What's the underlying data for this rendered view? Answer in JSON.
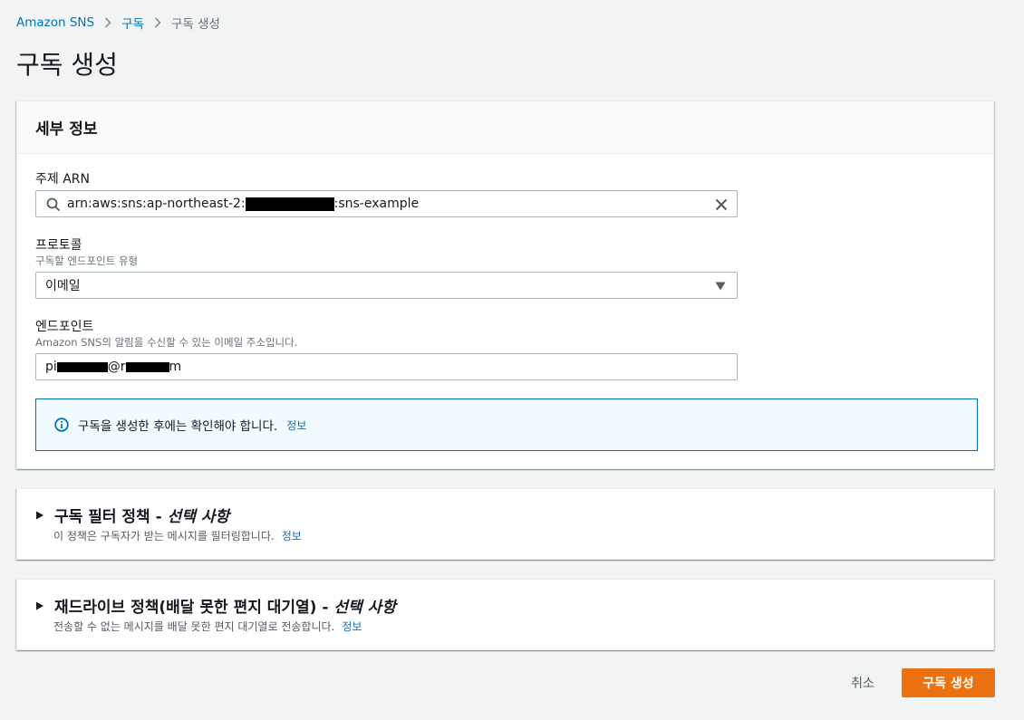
{
  "breadcrumb": {
    "items": [
      {
        "label": "Amazon SNS"
      },
      {
        "label": "구독"
      },
      {
        "label": "구독 생성"
      }
    ]
  },
  "page": {
    "title": "구독 생성"
  },
  "details": {
    "heading": "세부 정보",
    "topic_arn": {
      "label": "주제 ARN",
      "value_prefix": "arn:aws:sns:ap-northeast-2:",
      "value_suffix": ":sns-example",
      "icon": "search-icon",
      "clear_icon": "close-icon"
    },
    "protocol": {
      "label": "프로토콜",
      "description": "구독할 엔드포인트 유형",
      "value": "이메일",
      "icon": "caret-down-icon"
    },
    "endpoint": {
      "label": "엔드포인트",
      "description": "Amazon SNS의 알림을 수신할 수 있는 이메일 주소입니다.",
      "value_parts": [
        "pi",
        "@r",
        "m"
      ]
    },
    "alert": {
      "text": "구독을 생성한 후에는 확인해야 합니다.",
      "link": "정보",
      "icon": "info-icon"
    }
  },
  "filter_policy": {
    "title": "구독 필터 정책 - ",
    "title_optional": "선택 사항",
    "description": "이 정책은 구독자가 받는 메시지를 필터링합니다.",
    "link": "정보"
  },
  "redrive_policy": {
    "title": "재드라이브 정책(배달 못한 편지 대기열) - ",
    "title_optional": "선택 사항",
    "description": "전송할 수 없는 메시지를 배달 못한 편지 대기열로 전송합니다.",
    "link": "정보"
  },
  "actions": {
    "cancel": "취소",
    "create": "구독 생성"
  },
  "colors": {
    "link": "#0073bb",
    "primary": "#ec7211",
    "background": "#f2f3f3",
    "alert_bg": "#f1faff",
    "redaction": "#000000"
  }
}
